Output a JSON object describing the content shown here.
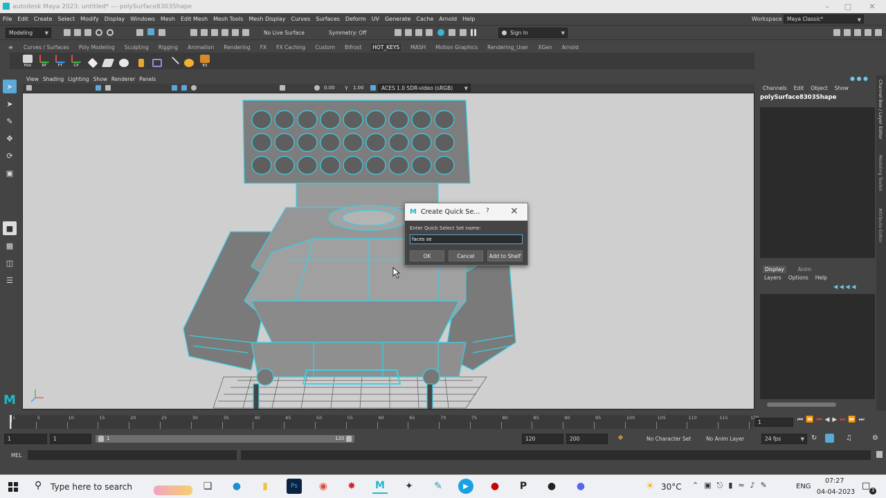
{
  "title_bar": {
    "title": "autodesk Maya 2023: untitled* --- polySurface8303Shape"
  },
  "menubar": {
    "items": [
      "File",
      "Edit",
      "Create",
      "Select",
      "Modify",
      "Display",
      "Windows",
      "Mesh",
      "Edit Mesh",
      "Mesh Tools",
      "Mesh Display",
      "Curves",
      "Surfaces",
      "Deform",
      "UV",
      "Generate",
      "Cache",
      "Arnold",
      "Help"
    ]
  },
  "workspace": {
    "label": "Workspace :",
    "value": "Maya Classic*"
  },
  "status_line": {
    "mode": "Modeling",
    "live_surface": "No Live Surface",
    "symmetry": "Symmetry: Off",
    "sign_in": "Sign In"
  },
  "shelf": {
    "tabs": [
      "Curves / Surfaces",
      "Poly Modeling",
      "Sculpting",
      "Rigging",
      "Animation",
      "Rendering",
      "FX",
      "FX Caching",
      "Custom",
      "Bifrost",
      "HOT_KEYS",
      "MASH",
      "Motion Graphics",
      "Rendering_User",
      "XGen",
      "Arnold"
    ],
    "active_tab": "HOT_KEYS",
    "buttons": [
      "Hist",
      "RT",
      "FT",
      "CP",
      "",
      "",
      "",
      "",
      "",
      "",
      "",
      "",
      "ES"
    ]
  },
  "viewport": {
    "menu": [
      "View",
      "Shading",
      "Lighting",
      "Show",
      "Renderer",
      "Panels"
    ],
    "exposure": "0.00",
    "gamma": "1.00",
    "color_space": "ACES 1.0 SDR-video (sRGB)"
  },
  "channel_box": {
    "menu": [
      "Channels",
      "Edit",
      "Object",
      "Show"
    ],
    "object_name": "polySurface8303Shape",
    "side_tabs": [
      "Channel Box / Layer Editor",
      "Modeling Toolkit",
      "Attribute Editor"
    ]
  },
  "layer_editor": {
    "tabs": [
      "Display",
      "Anim"
    ],
    "menu": [
      "Layers",
      "Options",
      "Help"
    ]
  },
  "dialog": {
    "title": "Create Quick Se...",
    "help": "?",
    "close": "×",
    "prompt": "Enter Quick Select Set name:",
    "input_value": "faces se",
    "ok": "OK",
    "cancel": "Cancel",
    "add_to_shelf": "Add to Shelf"
  },
  "time_slider": {
    "ticks": [
      "1",
      "5",
      "10",
      "15",
      "20",
      "25",
      "30",
      "35",
      "40",
      "45",
      "50",
      "55",
      "60",
      "65",
      "70",
      "75",
      "80",
      "85",
      "90",
      "95",
      "100",
      "105",
      "110",
      "115",
      "120"
    ],
    "current_frame": "1"
  },
  "range_slider": {
    "start": "1",
    "inner_start": "1",
    "slider_start": "1",
    "slider_end": "120",
    "end": "120",
    "outer_end": "200",
    "character_set": "No Character Set",
    "anim_layer": "No Anim Layer",
    "fps": "24 fps"
  },
  "command_line": {
    "label": "MEL"
  },
  "taskbar": {
    "search_placeholder": "Type here to search",
    "weather": "30°C",
    "language": "ENG",
    "time": "07:27",
    "date": "04-04-2023",
    "notification_count": "3"
  },
  "colors": {
    "wire": "#39d0e6",
    "maya_teal": "#1fb8c8",
    "panel": "#444444",
    "viewport_bg": "#cfcfcf"
  }
}
